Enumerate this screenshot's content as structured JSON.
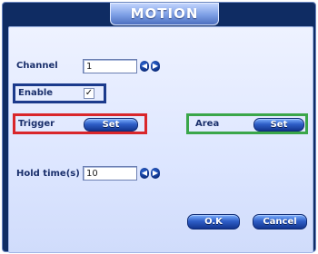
{
  "dialog": {
    "title": "MOTION"
  },
  "channel": {
    "label": "Channel",
    "value": "1"
  },
  "enable": {
    "label": "Enable",
    "checked": true,
    "check_glyph": "✓"
  },
  "trigger": {
    "label": "Trigger",
    "button_label": "Set"
  },
  "area": {
    "label": "Area",
    "button_label": "Set"
  },
  "hold_time": {
    "label": "Hold time(s)",
    "value": "10"
  },
  "buttons": {
    "ok_label": "O.K",
    "cancel_label": "Cancel"
  },
  "icons": {
    "left_arrow": "◀",
    "right_arrow": "▶"
  },
  "colors": {
    "enable_highlight": "#1b3a8c",
    "trigger_highlight": "#d9262b",
    "area_highlight": "#3aa64a"
  }
}
